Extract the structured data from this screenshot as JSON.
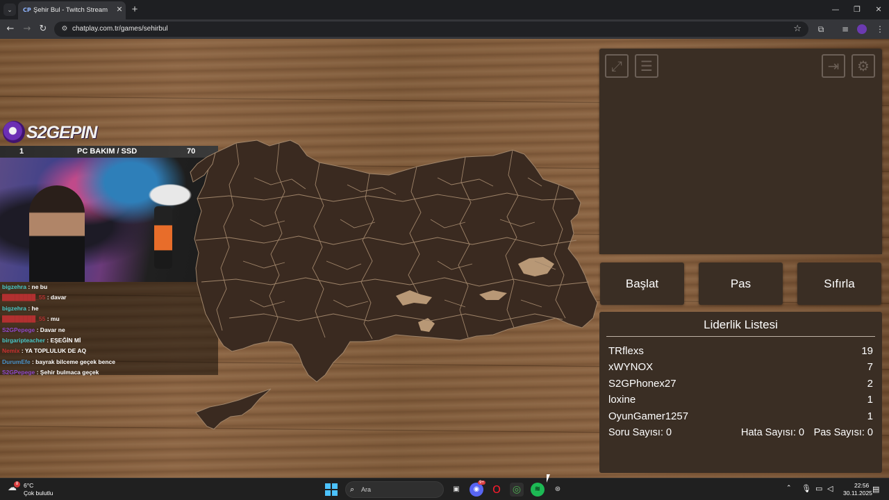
{
  "browser": {
    "tab_title": "Şehir Bul - Twitch Stream Game",
    "tab_favicon": "CP",
    "url": "chatplay.com.tr/games/sehirbul",
    "icons": [
      "tab-list-icon",
      "close-icon",
      "plus-icon",
      "minimize-icon",
      "restore-icon",
      "close-window-icon",
      "back-icon",
      "forward-icon",
      "reload-icon",
      "site-info-icon",
      "star-icon",
      "extensions-icon",
      "media-icon",
      "profile-icon",
      "menu-icon"
    ]
  },
  "stream_overlay": {
    "logo_text": "S2GEPIN",
    "bar_left": "1",
    "bar_title": "PC BAKIM / SSD",
    "bar_right": "70"
  },
  "chat": [
    {
      "user": "bigzehra",
      "text": ": ne bu",
      "color": "#48c9c9"
    },
    {
      "user": "████████_55",
      "text": ": davar",
      "color": "#b23030"
    },
    {
      "user": "bigzehra",
      "text": ": he",
      "color": "#48c9c9"
    },
    {
      "user": "████████_55",
      "text": ": mu",
      "color": "#b23030"
    },
    {
      "user": "S2GPepege",
      "text": ": Davar ne",
      "color": "#8e48c9"
    },
    {
      "user": "birgaripteacher",
      "text": ": EŞEĞİN Mİ",
      "color": "#48c9c9"
    },
    {
      "user": "Nemix",
      "text": ": YA TOPLULUK DE AQ",
      "color": "#c93030"
    },
    {
      "user": "DurumEfe",
      "text": ": bayrak bilceme geçek bence",
      "color": "#4891c9"
    },
    {
      "user": "S2GPepege",
      "text": ": Şehir bulmaca geçek",
      "color": "#8e48c9"
    }
  ],
  "controls": {
    "start": "Başlat",
    "pass": "Pas",
    "reset": "Sıfırla",
    "icons": [
      "fullscreen-icon",
      "document-icon",
      "exit-icon",
      "settings-icon"
    ]
  },
  "leaderboard": {
    "title": "Liderlik Listesi",
    "rows": [
      {
        "name": "TRflexs",
        "score": "19"
      },
      {
        "name": "xWYNOX",
        "score": "7"
      },
      {
        "name": "S2GPhonex27",
        "score": "2"
      },
      {
        "name": "loxine",
        "score": "1"
      },
      {
        "name": "OyunGamer1257",
        "score": "1"
      }
    ],
    "question_count": "Soru Sayısı: 0",
    "error_count": "Hata Sayısı: 0",
    "pass_count": "Pas Sayısı: 0"
  },
  "taskbar": {
    "weather_badge": "8",
    "weather_temp": "6°C",
    "weather_desc": "Çok bulutlu",
    "search_placeholder": "Ara",
    "discord_badge": "9+",
    "time": "22:56",
    "date": "30.11.2025"
  },
  "colors": {
    "panel": "#3a2e24",
    "map": "#3a2a20",
    "map_border": "#a0856a",
    "accent": "#4cc2ff"
  }
}
